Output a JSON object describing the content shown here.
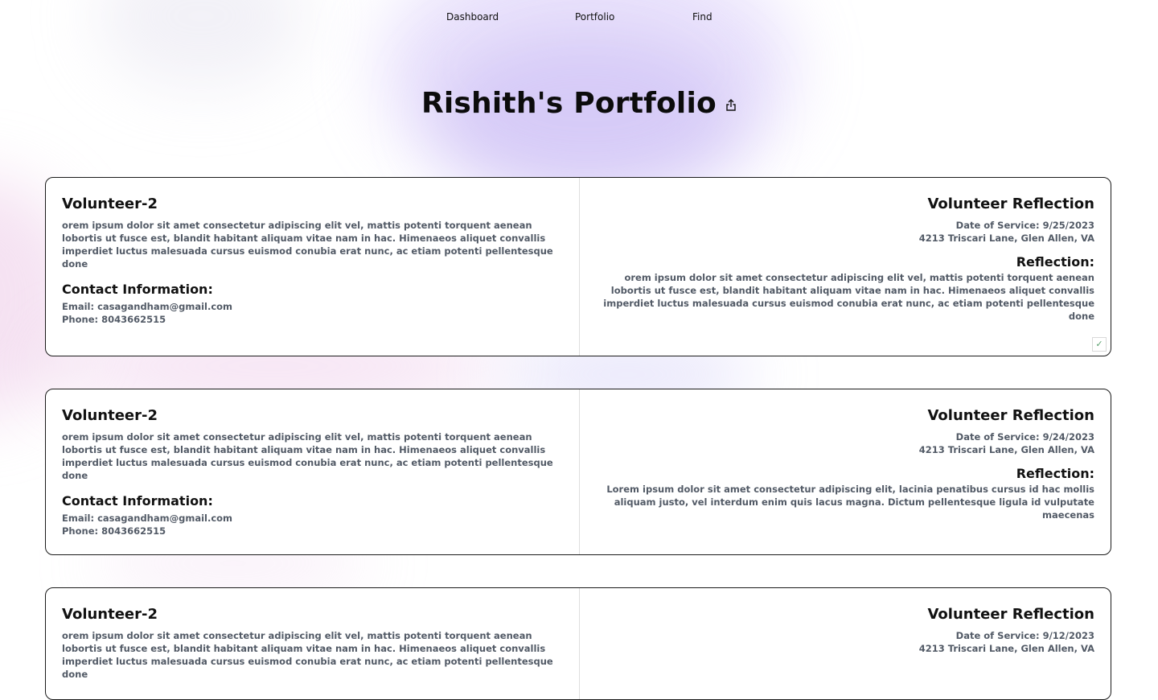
{
  "nav": {
    "dashboard": "Dashboard",
    "portfolio": "Portfolio",
    "find": "Find"
  },
  "page": {
    "title": "Rishith's Portfolio",
    "share_icon": "share-icon"
  },
  "cards": [
    {
      "name": "Volunteer-2",
      "description": "orem ipsum dolor sit amet consectetur adipiscing elit vel, mattis potenti torquent aenean lobortis ut fusce est, blandit habitant aliquam vitae nam in hac. Himenaeos aliquet convallis imperdiet luctus malesuada cursus euismod conubia erat nunc, ac etiam potenti pellentesque done",
      "contact_title": "Contact Information:",
      "email": "Email: casagandham@gmail.com",
      "phone": "Phone: 8043662515",
      "reflection_heading": "Volunteer Reflection",
      "date": "Date of Service: 9/25/2023",
      "address": "4213 Triscari Lane, Glen Allen, VA",
      "reflection_label": "Reflection:",
      "reflection": "orem ipsum dolor sit amet consectetur adipiscing elit vel, mattis potenti torquent aenean lobortis ut fusce est, blandit habitant aliquam vitae nam in hac. Himenaeos aliquet convallis imperdiet luctus malesuada cursus euismod conubia erat nunc, ac etiam potenti pellentesque done",
      "check": "✓"
    },
    {
      "name": "Volunteer-2",
      "description": "orem ipsum dolor sit amet consectetur adipiscing elit vel, mattis potenti torquent aenean lobortis ut fusce est, blandit habitant aliquam vitae nam in hac. Himenaeos aliquet convallis imperdiet luctus malesuada cursus euismod conubia erat nunc, ac etiam potenti pellentesque done",
      "contact_title": "Contact Information:",
      "email": "Email: casagandham@gmail.com",
      "phone": "Phone: 8043662515",
      "reflection_heading": "Volunteer Reflection",
      "date": "Date of Service: 9/24/2023",
      "address": "4213 Triscari Lane, Glen Allen, VA",
      "reflection_label": "Reflection:",
      "reflection": "Lorem ipsum dolor sit amet consectetur adipiscing elit, lacinia penatibus cursus id hac mollis aliquam justo, vel interdum enim quis lacus magna. Dictum pellentesque ligula id vulputate maecenas"
    },
    {
      "name": "Volunteer-2",
      "description": "orem ipsum dolor sit amet consectetur adipiscing elit vel, mattis potenti torquent aenean lobortis ut fusce est, blandit habitant aliquam vitae nam in hac. Himenaeos aliquet convallis imperdiet luctus malesuada cursus euismod conubia erat nunc, ac etiam potenti pellentesque done",
      "reflection_heading": "Volunteer Reflection",
      "date": "Date of Service: 9/12/2023",
      "address": "4213 Triscari Lane, Glen Allen, VA"
    }
  ]
}
